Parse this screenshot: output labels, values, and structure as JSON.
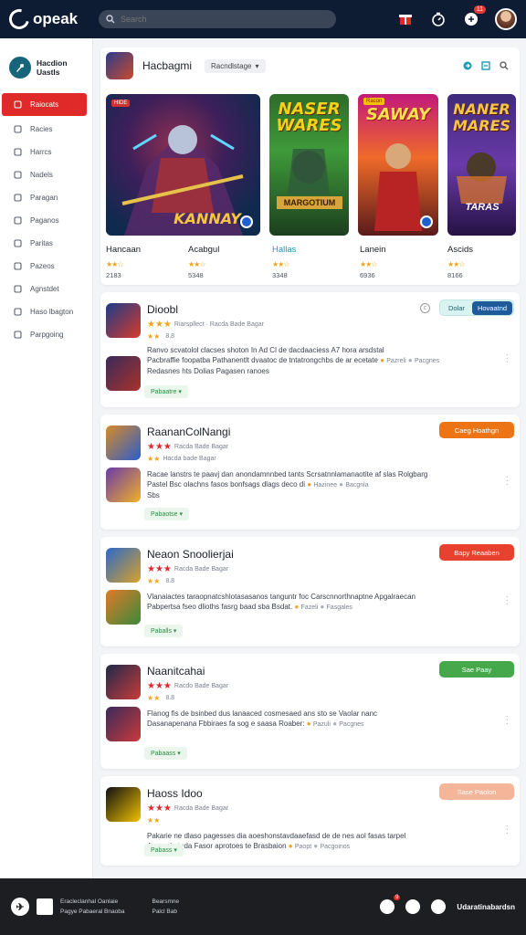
{
  "app": {
    "name": "opeak"
  },
  "search": {
    "placeholder": "Search"
  },
  "topbar": {
    "notif_count": "11"
  },
  "sidebar": {
    "brand_line1": "Hacdion",
    "brand_line2": "Uastls",
    "items": [
      {
        "label": "Raiocats",
        "icon": "home-icon"
      },
      {
        "label": "Racies",
        "icon": "user-icon"
      },
      {
        "label": "Harrcs",
        "icon": "chat-icon"
      },
      {
        "label": "Nadels",
        "icon": "bookmark-icon"
      },
      {
        "label": "Paragan",
        "icon": "chart-icon"
      },
      {
        "label": "Paganos",
        "icon": "shield-icon"
      },
      {
        "label": "Paritas",
        "icon": "calendar-icon"
      },
      {
        "label": "Pazeos",
        "icon": "tag-icon"
      },
      {
        "label": "Agnstdet",
        "icon": "mail-icon"
      },
      {
        "label": "Haso lbagton",
        "icon": "grid-icon"
      },
      {
        "label": "Parpgoing",
        "icon": "settings-icon"
      }
    ]
  },
  "featured": {
    "title": "Hacbagmi",
    "dropdown": "Racndlstage",
    "tiles": [
      {
        "name": "KANNAY",
        "badge": "HIDE",
        "caption": "",
        "label": "Hancaan",
        "count": "2183"
      },
      {
        "name": "NASER\nWARES",
        "badge": "",
        "caption": "MARGOTIUM",
        "label": "Acabgul",
        "count": "5348"
      },
      {
        "name": "SAWAY",
        "badge": "Racon",
        "caption": "",
        "label": "Hallas",
        "count": "3348"
      },
      {
        "name": "NANER\nMARES",
        "badge": "",
        "caption": "TARAS",
        "label": "Lanein",
        "count": "6936"
      },
      {
        "name": "",
        "badge": "",
        "caption": "",
        "label": "Ascids",
        "count": "8166"
      }
    ]
  },
  "games": [
    {
      "title": "Dioobl",
      "rating_meta": "Riarspllect · Racda Bade Bagar",
      "rating_meta2": "",
      "num": "8.8",
      "desc1": "Ranvo scvatolol clacses shoton In Ad Cl de dacdaaciess A7 hora arsdstal",
      "desc2": "Pacbraffie foopatba Pathanentlt dvaatoc de tntatrongchbs de ar ecetate",
      "desc3": "Redasnes hts Dolias Pagasen ranoes",
      "link1": "Pazreli",
      "link2": "Pacgnes",
      "tag": "Pabaatre",
      "btn_left": "Dolar",
      "btn_right": "Hovaatnd"
    },
    {
      "title": "RaananColNangi",
      "rating_meta": "Racda Bade Bagar",
      "rating_meta2": "Hacda bade Bagar",
      "num": "",
      "desc1": "Racae lanstrs te paavj dan anondamnnbed tants Scrsatnnlamanaotite af slas Rolgbarg",
      "desc2": "Pastel Bsc olachns fasos bonfsags dlags deco di",
      "desc3": "Sbs",
      "link1": "Hazinee",
      "link2": "Bacgnla",
      "tag": "Pabaotse",
      "btn": "Caeg Hoathgn",
      "btn_color": "#ed7414"
    },
    {
      "title": "Neaon Snoolierjai",
      "rating_meta": "Racda Bade Bagar",
      "rating_meta2": "",
      "num": "8.8",
      "desc1": "Vlanaiactes taraopnatcshlotasasanos tanguntr foc Carscnnorthnaptne Apgalraecan",
      "desc2": "Pabpertsa fseo dlioths fasrg baad sba Bsdat.",
      "desc3": "",
      "link1": "Fazeli",
      "link2": "Fasgales",
      "tag": "Paballs",
      "btn": "Bapy Reaaben",
      "btn_color": "#e8412f"
    },
    {
      "title": "Naanitcahai",
      "rating_meta": "Racdo Bade Bagar",
      "rating_meta2": "",
      "num": "8.8",
      "desc1": "Flanog fis de bsinbed dus lanaaced cosmesaed ans sto se Vaolar nanc",
      "desc2": "Dasanapenana Fbbiraes fa sog e saasa Roaber:",
      "desc3": "",
      "link1": "Pazuli",
      "link2": "Pacgnes",
      "tag": "Pabaass",
      "btn": "Sae Paay",
      "btn_color": "#45a84a"
    },
    {
      "title": "Haoss Idoo",
      "rating_meta": "Racda Bade Bagar",
      "rating_meta2": "",
      "num": "",
      "desc1": "Pakarie ne dlaso pagesses dia aoeshonstavdaaefasd de de nes aol fasas tarpel",
      "desc2": "Agseudo teda Fasor aprotoes te Brasbaion",
      "desc3": "",
      "link1": "Paopt",
      "link2": "Pacgoinos",
      "tag": "Pabass",
      "btn": "Sase Paolon",
      "btn_color": "#f5b599"
    }
  ],
  "footer": {
    "col1_line1": "Eracleclanhal Oanlaie",
    "col1_line2": "Pagye Pabaeral Bnaoba",
    "col2_line1": "Bearsmne",
    "col2_line2": "Palcl Bab",
    "brand": "Udaratinabardsn",
    "notif_count": "9"
  }
}
